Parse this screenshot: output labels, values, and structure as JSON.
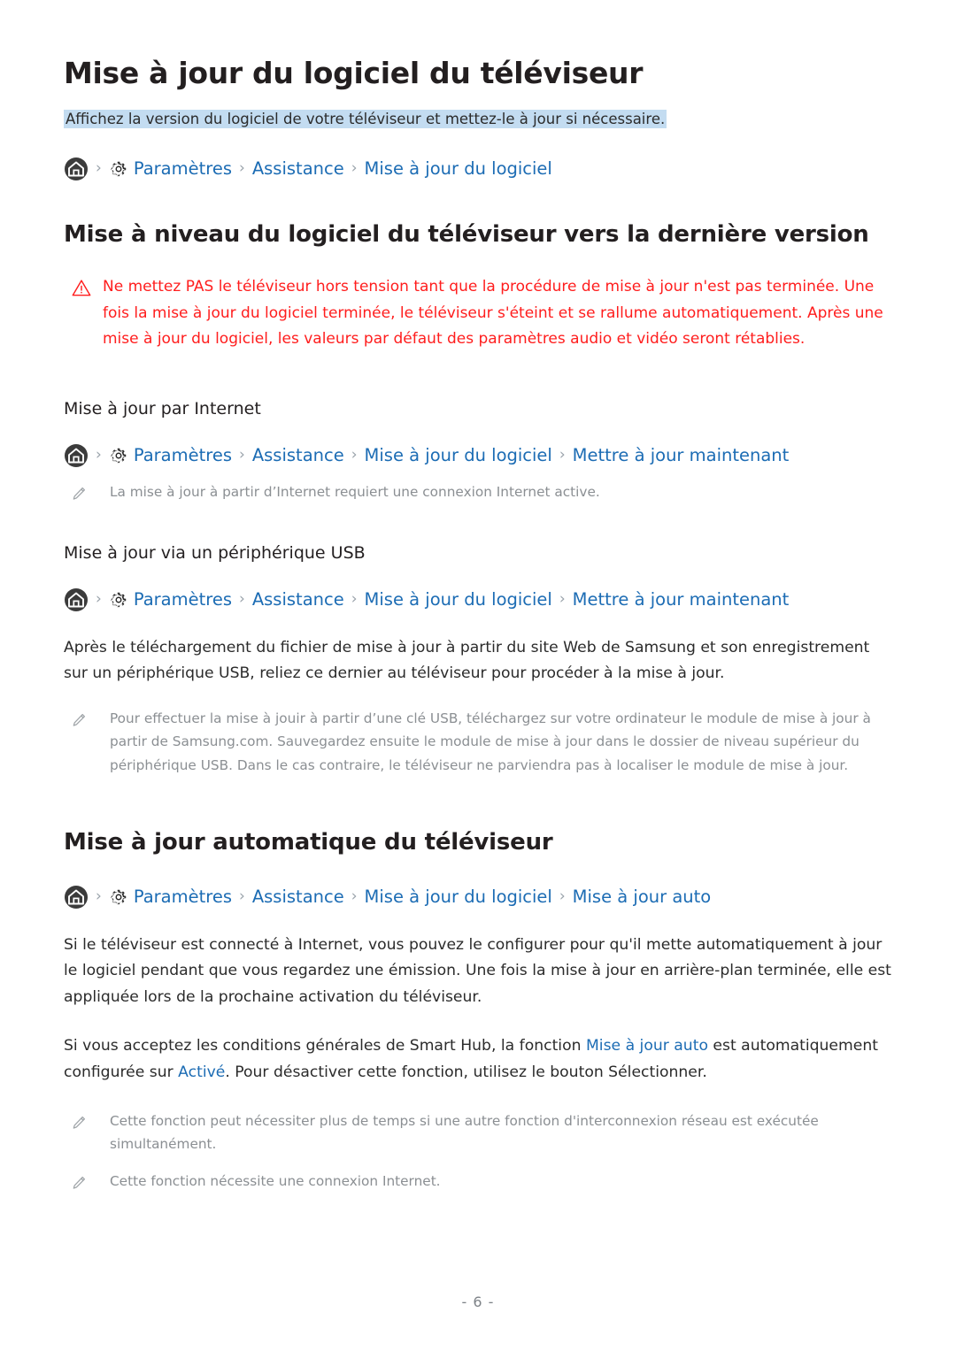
{
  "page": {
    "title": "Mise à jour du logiciel du téléviseur",
    "subtitle": "Affichez la version du logiciel de votre téléviseur et mettez-le à jour si nécessaire.",
    "footer": "- 6 -"
  },
  "colors": {
    "link": "#1c6cb4",
    "warning": "#ff1d1d",
    "highlight": "#c3dcf1",
    "note_text": "#8b8f93",
    "body_text": "#2b2b2b"
  },
  "icons": {
    "home": "home-icon",
    "gear": "gear-icon",
    "warning": "warning-triangle-icon",
    "note": "pencil-icon",
    "separator": "chevron-right-icon"
  },
  "breadcrumbs": {
    "main": {
      "separator": "›",
      "items": [
        "Paramètres",
        "Assistance",
        "Mise à jour du logiciel"
      ]
    },
    "internet": {
      "separator": "›",
      "items": [
        "Paramètres",
        "Assistance",
        "Mise à jour du logiciel",
        "Mettre à jour maintenant"
      ]
    },
    "usb": {
      "separator": "›",
      "items": [
        "Paramètres",
        "Assistance",
        "Mise à jour du logiciel",
        "Mettre à jour maintenant"
      ]
    },
    "auto": {
      "separator": "›",
      "items": [
        "Paramètres",
        "Assistance",
        "Mise à jour du logiciel",
        "Mise à jour auto"
      ]
    }
  },
  "sections": {
    "upgrade": {
      "heading": "Mise à niveau du logiciel du téléviseur vers la dernière version",
      "warning": "Ne mettez PAS le téléviseur hors tension tant que la procédure de mise à jour n'est pas terminée. Une fois la mise à jour du logiciel terminée, le téléviseur s'éteint et se rallume automatiquement. Après une mise à jour du logiciel, les valeurs par défaut des paramètres audio et vidéo seront rétablies."
    },
    "internet": {
      "heading": "Mise à jour par Internet",
      "note": "La mise à jour à partir d’Internet requiert une connexion Internet active."
    },
    "usb": {
      "heading": "Mise à jour via un périphérique USB",
      "paragraph": "Après le téléchargement du fichier de mise à jour à partir du site Web de Samsung et son enregistrement sur un périphérique USB, reliez ce dernier au téléviseur pour procéder à la mise à jour.",
      "note": "Pour effectuer la mise à jouir à partir d’une clé USB, téléchargez sur votre ordinateur le module de mise à jour à partir de Samsung.com. Sauvegardez ensuite le module de mise à jour dans le dossier de niveau supérieur du périphérique USB. Dans le cas contraire, le téléviseur ne parviendra pas à localiser le module de mise à jour."
    },
    "auto": {
      "heading": "Mise à jour automatique du téléviseur",
      "paragraph1": "Si le téléviseur est connecté à Internet, vous pouvez le configurer pour qu'il mette automatiquement à jour le logiciel pendant que vous regardez une émission. Une fois la mise à jour en arrière-plan terminée, elle est appliquée lors de la prochaine activation du téléviseur.",
      "paragraph2_part1": "Si vous acceptez les conditions générales de Smart Hub, la fonction ",
      "paragraph2_link1": "Mise à jour auto",
      "paragraph2_part2": " est automatiquement configurée sur ",
      "paragraph2_link2": "Activé",
      "paragraph2_part3": ". Pour désactiver cette fonction, utilisez le bouton Sélectionner.",
      "note1": "Cette fonction peut nécessiter plus de temps si une autre fonction d'interconnexion réseau est exécutée simultanément.",
      "note2": "Cette fonction nécessite une connexion Internet."
    }
  }
}
